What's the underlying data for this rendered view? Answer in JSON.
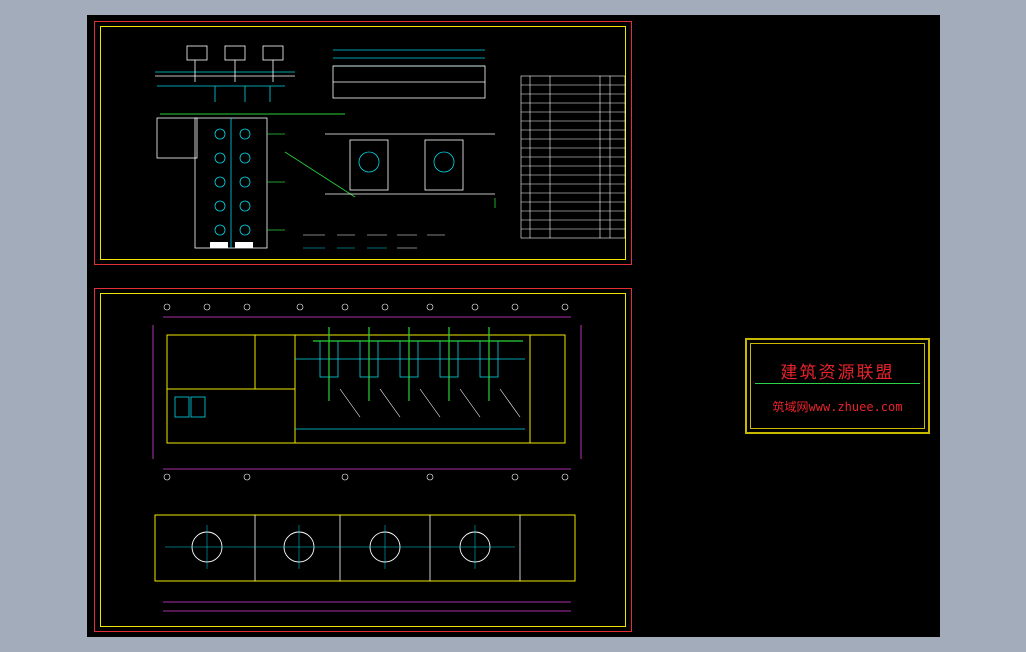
{
  "watermark": {
    "title": "建筑资源联盟",
    "site": "筑域网www.zhuee.com"
  },
  "colors": {
    "background": "#a3acbb",
    "canvas": "#000000",
    "sheet_border": "#e0303a",
    "frame": "#f2e600",
    "cyan": "#00d8e8",
    "green": "#2ad23a",
    "magenta": "#e040e0",
    "white": "#ffffff",
    "yellow": "#f2e600"
  }
}
